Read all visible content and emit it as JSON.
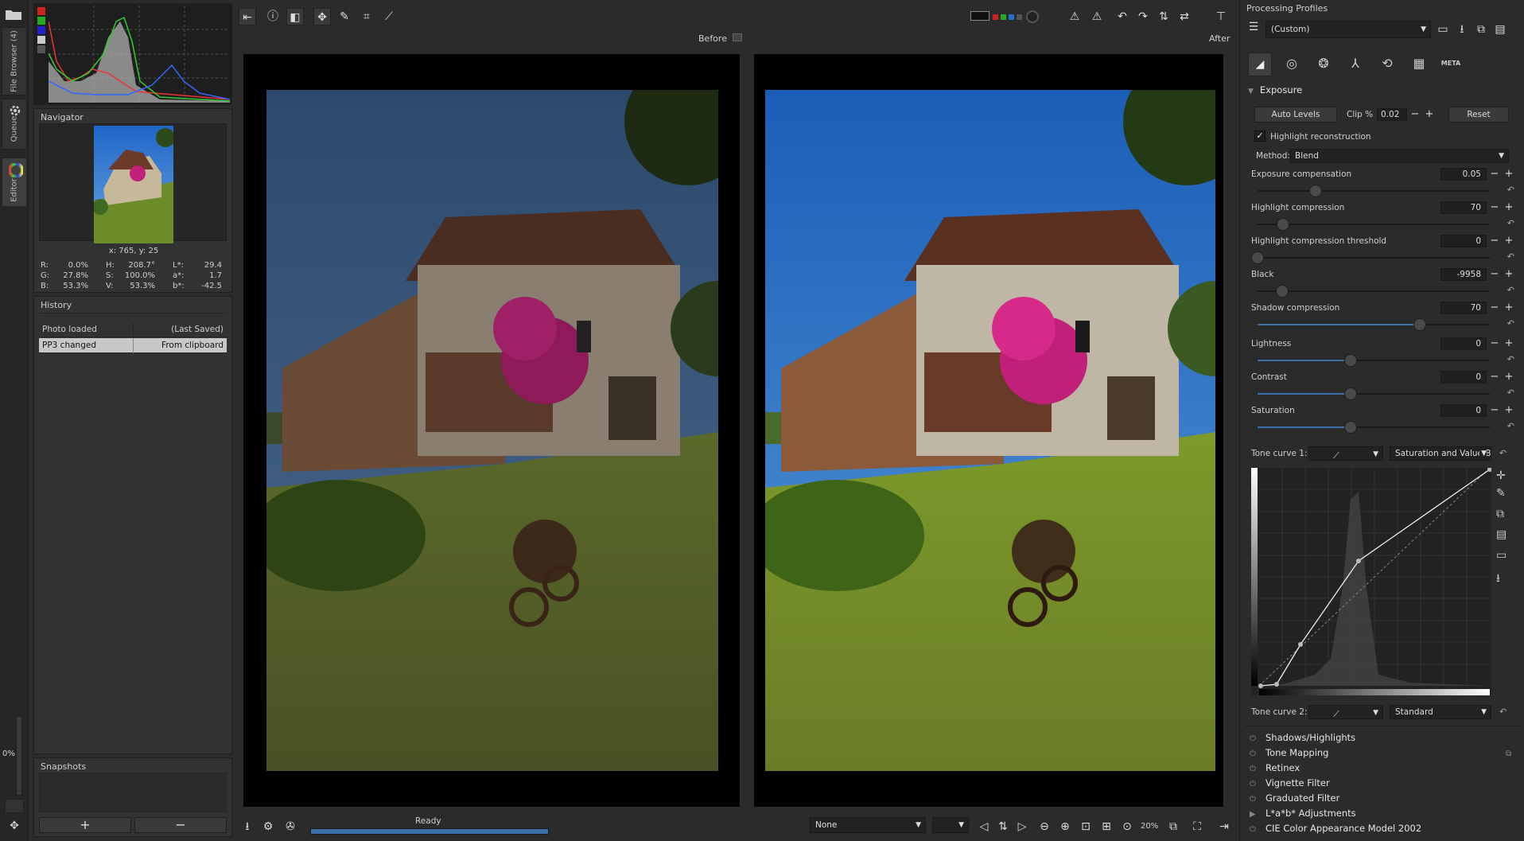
{
  "colors": {
    "bg": "#2b2b2b",
    "panel": "#323232",
    "accent": "#3b6fa8",
    "sky_before": "#2e4d72",
    "sky_after": "#1f66c8"
  },
  "left_tabs": [
    "File Browser (4)",
    "Queue",
    "Editor"
  ],
  "zoom_side": "0%",
  "navigator": {
    "title": "Navigator",
    "coords": "x: 765, y: 25",
    "rgb": [
      [
        "R:",
        "0.0%"
      ],
      [
        "G:",
        "27.8%"
      ],
      [
        "B:",
        "53.3%"
      ]
    ],
    "hsv": [
      [
        "H:",
        "208.7°"
      ],
      [
        "S:",
        "100.0%"
      ],
      [
        "V:",
        "53.3%"
      ]
    ],
    "lab": [
      [
        "L*:",
        "29.4"
      ],
      [
        "a*:",
        "1.7"
      ],
      [
        "b*:",
        "-42.5"
      ]
    ]
  },
  "history": {
    "title": "History",
    "rows": [
      {
        "action": "Photo loaded",
        "detail": "(Last Saved)",
        "selected": false
      },
      {
        "action": "PP3 changed",
        "detail": "From clipboard",
        "selected": true
      }
    ]
  },
  "snapshots": {
    "title": "Snapshots",
    "add_icon": "+",
    "remove_icon": "−"
  },
  "viewer": {
    "before_label": "Before",
    "after_label": "After"
  },
  "status": {
    "text": "Ready",
    "progress": 1.0,
    "filter_select": "None",
    "zoom": "20%"
  },
  "right": {
    "profiles_title": "Processing Profiles",
    "profile_value": "(Custom)",
    "meta_label": "META",
    "exposure": {
      "title": "Exposure",
      "auto_levels": "Auto Levels",
      "clip_label": "Clip %",
      "clip_value": "0.02",
      "reset": "Reset",
      "highlight_reconstruction": "Highlight reconstruction",
      "method_label": "Method:",
      "method_value": "Blend",
      "sliders": [
        {
          "label": "Exposure compensation",
          "value": "0.05",
          "pos": 0.25,
          "fill": false
        },
        {
          "label": "Highlight compression",
          "value": "70",
          "pos": 0.11,
          "fill": false
        },
        {
          "label": "Highlight compression threshold",
          "value": "0",
          "pos": 0.0,
          "fill": false
        },
        {
          "label": "Black",
          "value": "-9958",
          "pos": 0.105,
          "fill": false
        },
        {
          "label": "Shadow compression",
          "value": "70",
          "pos": 0.7,
          "fill": true
        },
        {
          "label": "Lightness",
          "value": "0",
          "pos": 0.4,
          "fill": true
        },
        {
          "label": "Contrast",
          "value": "0",
          "pos": 0.4,
          "fill": true
        },
        {
          "label": "Saturation",
          "value": "0",
          "pos": 0.4,
          "fill": true
        }
      ],
      "tone_curve_1_label": "Tone curve 1:",
      "tone_curve_1_mode": "Saturation and Value B",
      "tone_curve_2_label": "Tone curve 2:",
      "tone_curve_2_mode": "Standard"
    },
    "sections": [
      {
        "label": "Shadows/Highlights",
        "icon": "power"
      },
      {
        "label": "Tone Mapping",
        "icon": "power"
      },
      {
        "label": "Retinex",
        "icon": "power"
      },
      {
        "label": "Vignette Filter",
        "icon": "power"
      },
      {
        "label": "Graduated Filter",
        "icon": "power"
      },
      {
        "label": "L*a*b* Adjustments",
        "icon": "expand"
      },
      {
        "label": "CIE Color Appearance Model 2002",
        "icon": "power"
      }
    ]
  }
}
